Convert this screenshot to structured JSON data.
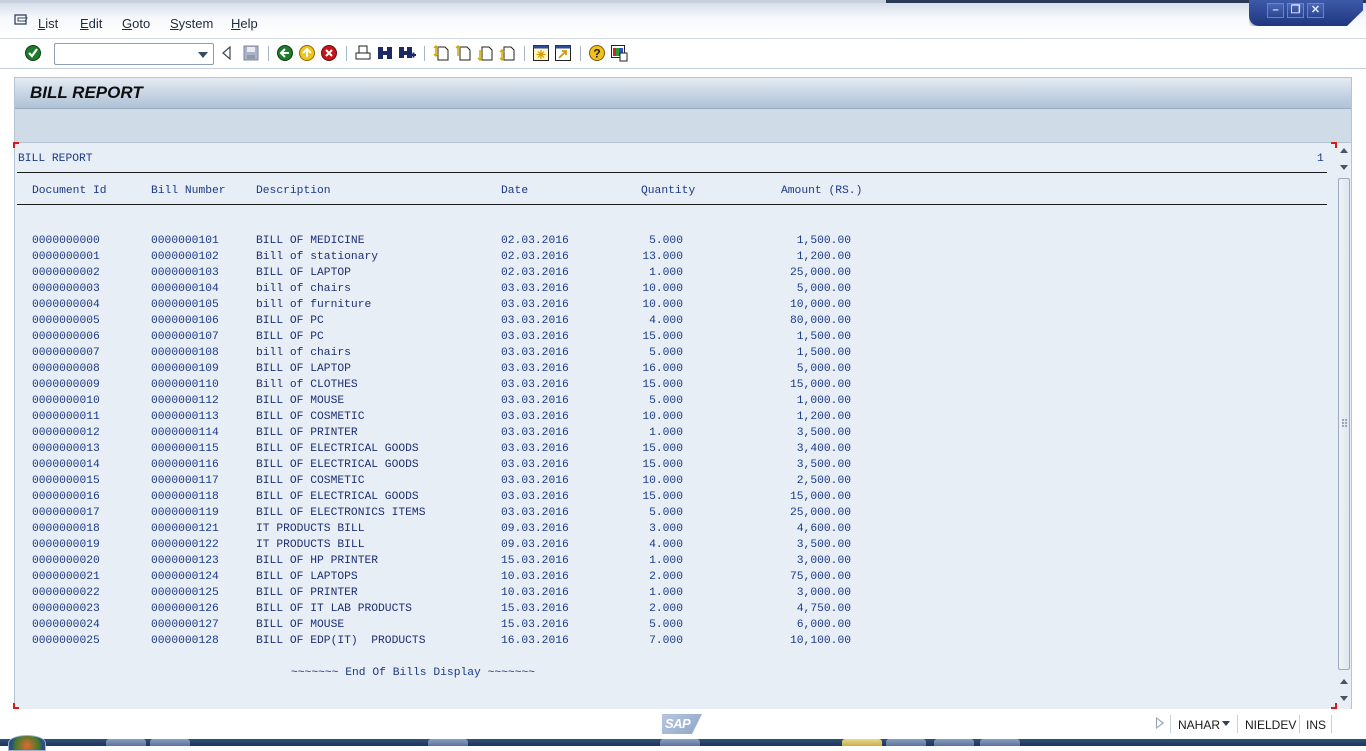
{
  "menubar": {
    "items": [
      "List",
      "Edit",
      "Goto",
      "System",
      "Help"
    ]
  },
  "window_controls": {
    "minimize": "–",
    "restore": "❐",
    "close": "✕"
  },
  "toolbar": {
    "command_field_value": "",
    "icons": [
      "enter-icon",
      "back-nav-icon",
      "save-icon",
      "back-icon",
      "exit-icon",
      "cancel-icon",
      "print-icon",
      "find-icon",
      "find-next-icon",
      "first-page-icon",
      "previous-page-icon",
      "next-page-icon",
      "last-page-icon",
      "create-session-icon",
      "shortcut-icon",
      "help-icon",
      "customize-layout-icon"
    ]
  },
  "screen": {
    "title": "BILL REPORT"
  },
  "report": {
    "heading": "BILL REPORT",
    "page_number": "1",
    "columns": {
      "document_id": "Document Id",
      "bill_number": "Bill Number",
      "description": "Description",
      "date": "Date",
      "quantity": "Quantity",
      "amount": "Amount (RS.)"
    },
    "rows": [
      {
        "doc": "0000000000",
        "bill": "0000000101",
        "desc": "BILL OF MEDICINE",
        "date": "02.03.2016",
        "qty": "5.000",
        "amt": "1,500.00"
      },
      {
        "doc": "0000000001",
        "bill": "0000000102",
        "desc": "Bill of stationary",
        "date": "02.03.2016",
        "qty": "13.000",
        "amt": "1,200.00"
      },
      {
        "doc": "0000000002",
        "bill": "0000000103",
        "desc": "BILL OF LAPTOP",
        "date": "02.03.2016",
        "qty": "1.000",
        "amt": "25,000.00"
      },
      {
        "doc": "0000000003",
        "bill": "0000000104",
        "desc": "bill of chairs",
        "date": "03.03.2016",
        "qty": "10.000",
        "amt": "5,000.00"
      },
      {
        "doc": "0000000004",
        "bill": "0000000105",
        "desc": "bill of furniture",
        "date": "03.03.2016",
        "qty": "10.000",
        "amt": "10,000.00"
      },
      {
        "doc": "0000000005",
        "bill": "0000000106",
        "desc": "BILL OF PC",
        "date": "03.03.2016",
        "qty": "4.000",
        "amt": "80,000.00"
      },
      {
        "doc": "0000000006",
        "bill": "0000000107",
        "desc": "BILL OF PC",
        "date": "03.03.2016",
        "qty": "15.000",
        "amt": "1,500.00"
      },
      {
        "doc": "0000000007",
        "bill": "0000000108",
        "desc": "bill of chairs",
        "date": "03.03.2016",
        "qty": "5.000",
        "amt": "1,500.00"
      },
      {
        "doc": "0000000008",
        "bill": "0000000109",
        "desc": "BILL OF LAPTOP",
        "date": "03.03.2016",
        "qty": "16.000",
        "amt": "5,000.00"
      },
      {
        "doc": "0000000009",
        "bill": "0000000110",
        "desc": "Bill of CLOTHES",
        "date": "03.03.2016",
        "qty": "15.000",
        "amt": "15,000.00"
      },
      {
        "doc": "0000000010",
        "bill": "0000000112",
        "desc": "BILL OF MOUSE",
        "date": "03.03.2016",
        "qty": "5.000",
        "amt": "1,000.00"
      },
      {
        "doc": "0000000011",
        "bill": "0000000113",
        "desc": "BILL OF COSMETIC",
        "date": "03.03.2016",
        "qty": "10.000",
        "amt": "1,200.00"
      },
      {
        "doc": "0000000012",
        "bill": "0000000114",
        "desc": "BILL OF PRINTER",
        "date": "03.03.2016",
        "qty": "1.000",
        "amt": "3,500.00"
      },
      {
        "doc": "0000000013",
        "bill": "0000000115",
        "desc": "BILL OF ELECTRICAL GOODS",
        "date": "03.03.2016",
        "qty": "15.000",
        "amt": "3,400.00"
      },
      {
        "doc": "0000000014",
        "bill": "0000000116",
        "desc": "BILL OF ELECTRICAL GOODS",
        "date": "03.03.2016",
        "qty": "15.000",
        "amt": "3,500.00"
      },
      {
        "doc": "0000000015",
        "bill": "0000000117",
        "desc": "BILL OF COSMETIC",
        "date": "03.03.2016",
        "qty": "10.000",
        "amt": "2,500.00"
      },
      {
        "doc": "0000000016",
        "bill": "0000000118",
        "desc": "BILL OF ELECTRICAL GOODS",
        "date": "03.03.2016",
        "qty": "15.000",
        "amt": "15,000.00"
      },
      {
        "doc": "0000000017",
        "bill": "0000000119",
        "desc": "BILL OF ELECTRONICS ITEMS",
        "date": "03.03.2016",
        "qty": "5.000",
        "amt": "25,000.00"
      },
      {
        "doc": "0000000018",
        "bill": "0000000121",
        "desc": "IT PRODUCTS BILL",
        "date": "09.03.2016",
        "qty": "3.000",
        "amt": "4,600.00"
      },
      {
        "doc": "0000000019",
        "bill": "0000000122",
        "desc": "IT PRODUCTS BILL",
        "date": "09.03.2016",
        "qty": "4.000",
        "amt": "3,500.00"
      },
      {
        "doc": "0000000020",
        "bill": "0000000123",
        "desc": "BILL OF HP PRINTER",
        "date": "15.03.2016",
        "qty": "1.000",
        "amt": "3,000.00"
      },
      {
        "doc": "0000000021",
        "bill": "0000000124",
        "desc": "BILL OF LAPTOPS",
        "date": "10.03.2016",
        "qty": "2.000",
        "amt": "75,000.00"
      },
      {
        "doc": "0000000022",
        "bill": "0000000125",
        "desc": "BILL OF PRINTER",
        "date": "10.03.2016",
        "qty": "1.000",
        "amt": "3,000.00"
      },
      {
        "doc": "0000000023",
        "bill": "0000000126",
        "desc": "BILL OF IT LAB PRODUCTS",
        "date": "15.03.2016",
        "qty": "2.000",
        "amt": "4,750.00"
      },
      {
        "doc": "0000000024",
        "bill": "0000000127",
        "desc": "BILL OF MOUSE",
        "date": "15.03.2016",
        "qty": "5.000",
        "amt": "6,000.00"
      },
      {
        "doc": "0000000025",
        "bill": "0000000128",
        "desc": "BILL OF EDP(IT)  PRODUCTS",
        "date": "16.03.2016",
        "qty": "7.000",
        "amt": "10,100.00"
      }
    ],
    "footer": "~~~~~~~ End Of Bills Display ~~~~~~~"
  },
  "statusbar": {
    "logo": "SAP",
    "system": "NAHAR",
    "server": "NIELDEV",
    "mode": "INS"
  }
}
